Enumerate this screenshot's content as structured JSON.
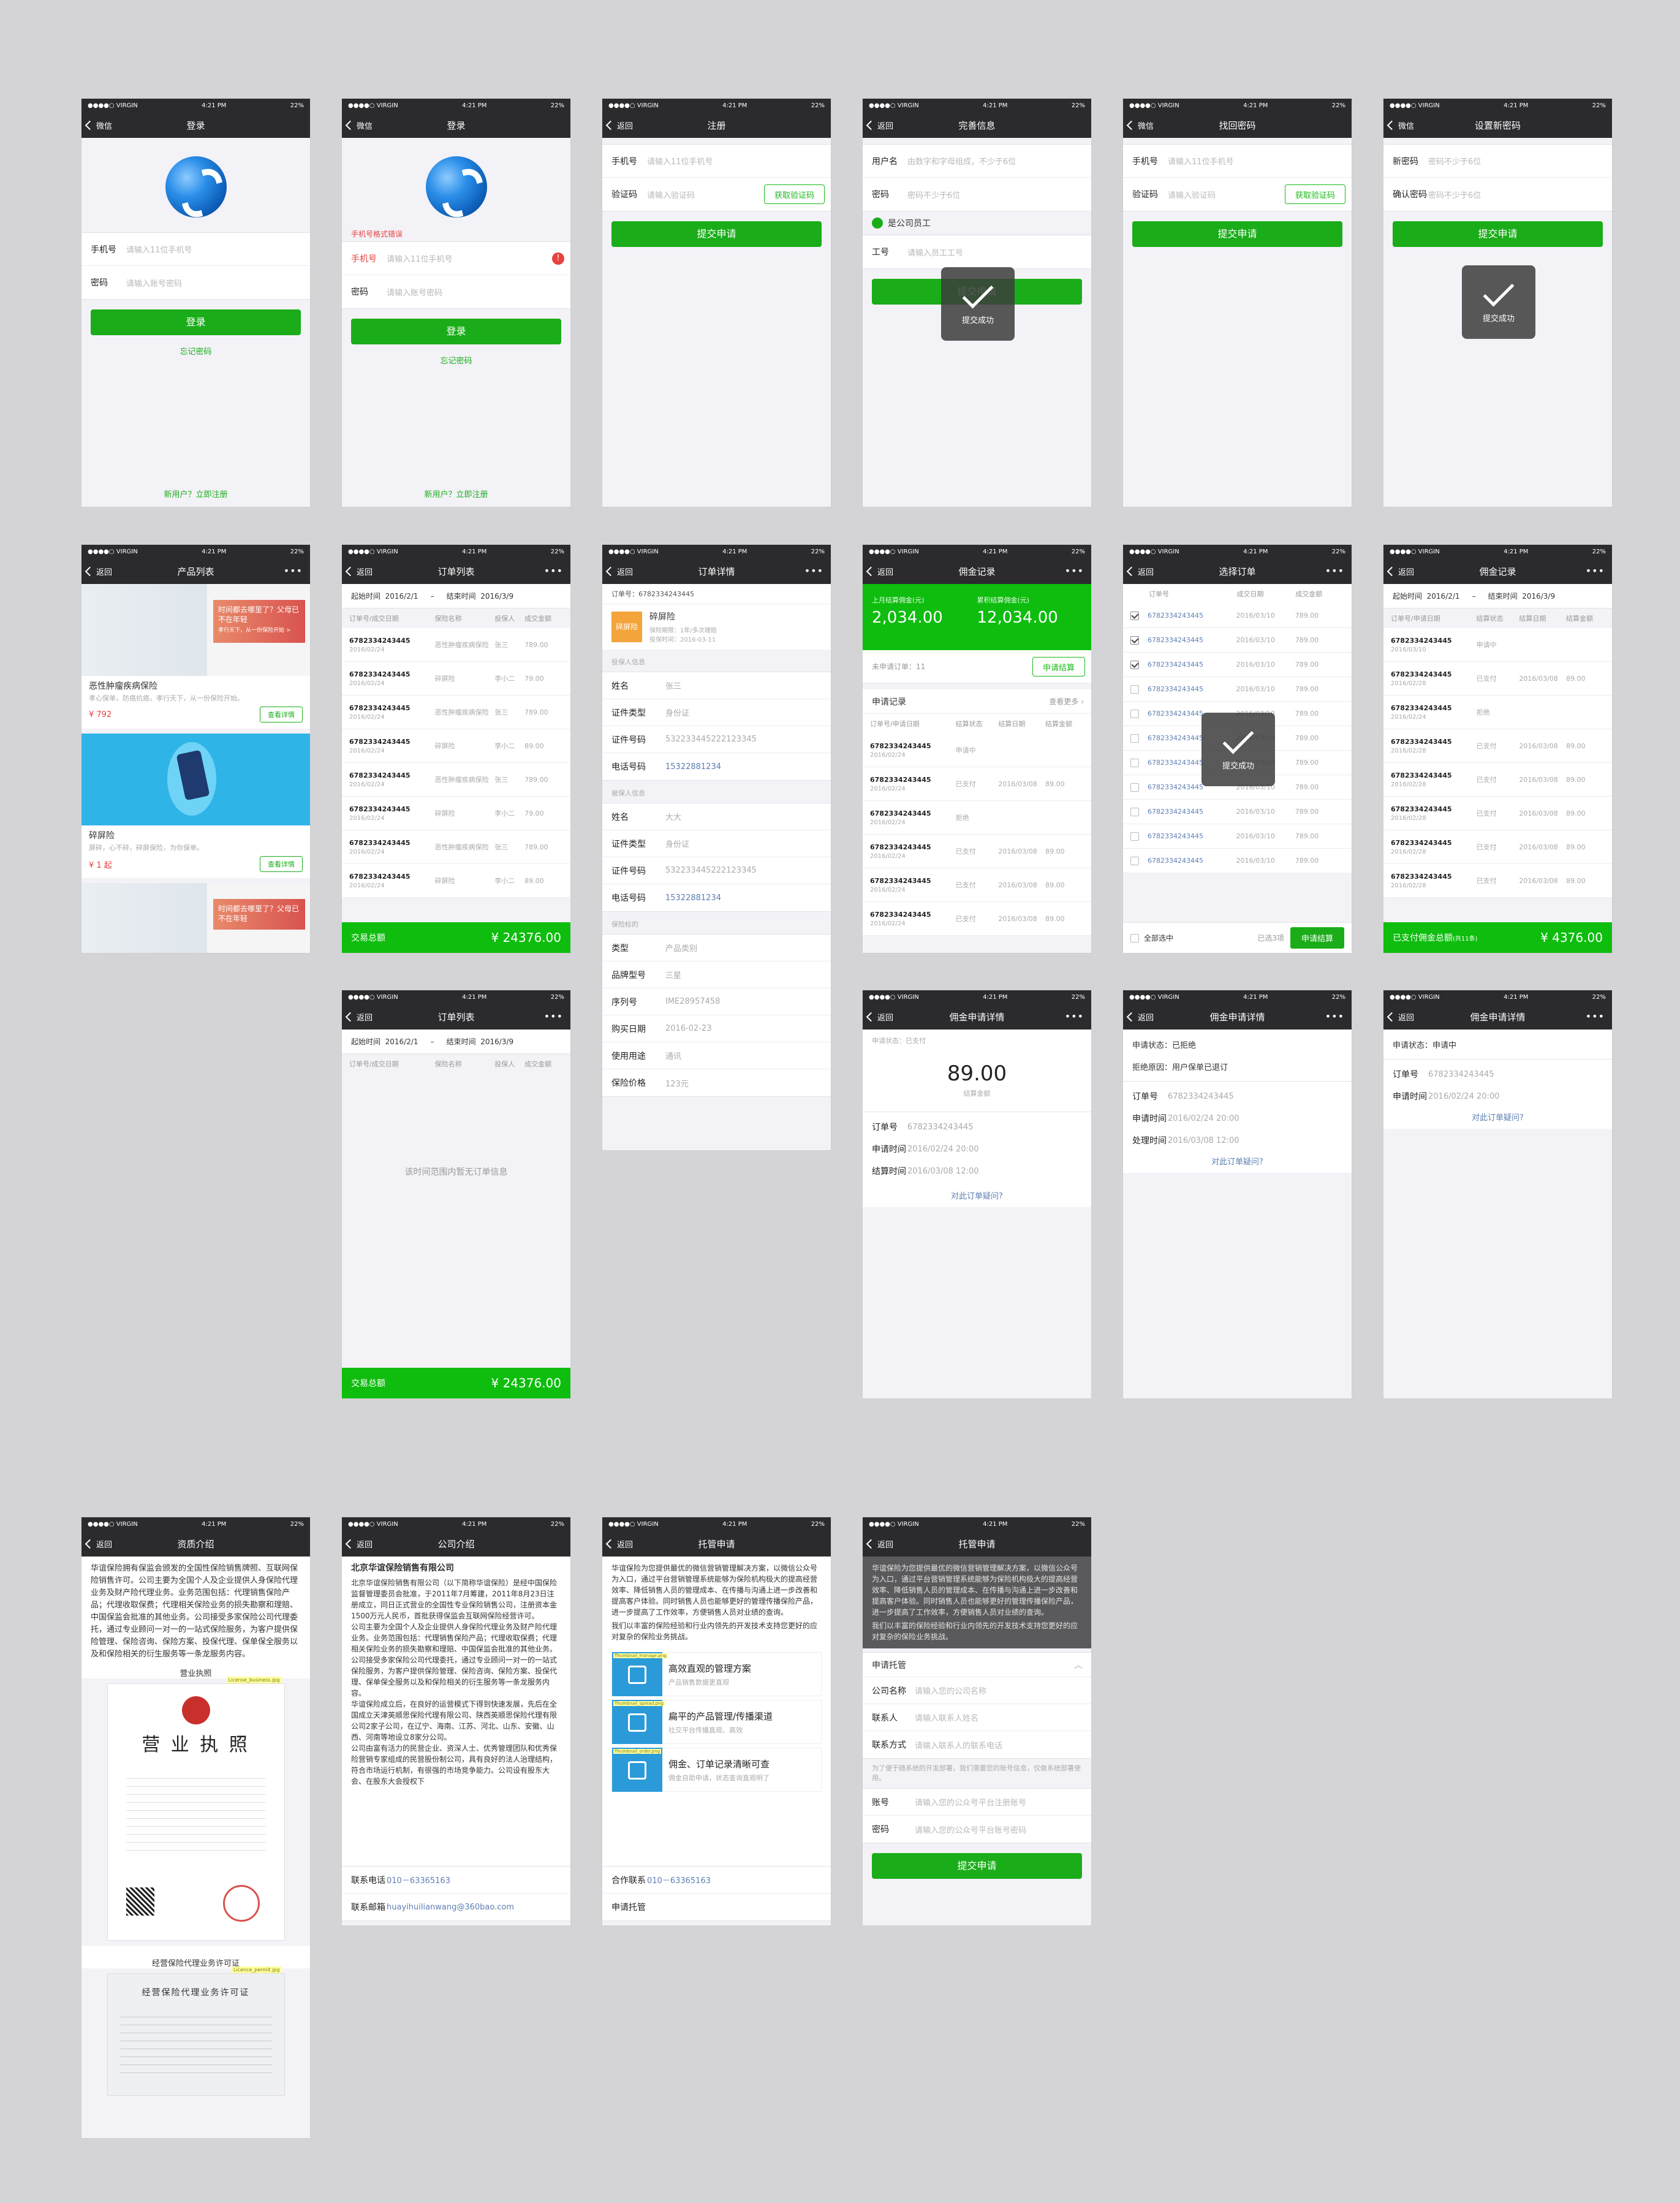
{
  "status": {
    "carrier": "●●●●○ VIRGIN",
    "time": "4:21 PM",
    "battery": "22%"
  },
  "common": {
    "back": "返回",
    "back_wechat": "微信",
    "more": "•••",
    "submit": "提交申请",
    "get_code": "获取验证码",
    "toast": "提交成功",
    "dispute": "对此订单疑问?",
    "order_no_label": "订单号",
    "apply_time_label": "申请时间",
    "settle_time_label": "结算时间",
    "process_time_label": "处理时间"
  },
  "login": {
    "title": "登录",
    "phone_label": "手机号",
    "phone_ph": "请输入11位手机号",
    "pwd_label": "密码",
    "pwd_ph": "请输入账号密码",
    "btn": "登录",
    "forgot": "忘记密码",
    "register": "新用户？立即注册",
    "error": "手机号格式错误",
    "err_icon": "!"
  },
  "register": {
    "title": "注册",
    "phone_label": "手机号",
    "phone_ph": "请输入11位手机号",
    "code_label": "验证码",
    "code_ph": "请输入验证码"
  },
  "complete": {
    "title": "完善信息",
    "user_label": "用户名",
    "user_ph": "由数字和字母组成，不少于6位",
    "pwd_label": "密码",
    "pwd_ph": "密码不少于6位",
    "employee": "是公司员工",
    "id_label": "工号",
    "id_ph": "请输入员工工号"
  },
  "recover": {
    "title": "找回密码"
  },
  "newpwd": {
    "title": "设置新密码",
    "new_label": "新密码",
    "new_ph": "密码不少于6位",
    "confirm_label": "确认密码",
    "confirm_ph": "密码不少于6位"
  },
  "products": {
    "title": "产品列表",
    "items": [
      {
        "name": "恶性肿瘤疾病保险",
        "desc": "孝心保单，防癌抗癌，孝行天下，从一份保险开始。",
        "price": "¥ 792",
        "view": "查看详情",
        "banner": "时间都去哪里了？父母已不在年轻",
        "banner_sub": "孝行天下，从一份保险开始 >"
      },
      {
        "name": "碎屏险",
        "desc": "屏碎，心不碎，碎屏保险，为你保单。",
        "price": "¥ 1 起",
        "view": "查看详情"
      }
    ],
    "third_banner": "时间都去哪里了？父母已不在年轻"
  },
  "orders": {
    "title": "订单列表",
    "from_label": "起始时间",
    "from": "2016/2/1",
    "sep": "–",
    "to_label": "结束时间",
    "to": "2016/3/9",
    "cols": [
      "订单号/成交日期",
      "保险名称",
      "投保人",
      "成交金额"
    ],
    "rows": [
      {
        "no": "6782334243445",
        "date": "2016/02/24",
        "name": "恶性肿瘤疾病保险",
        "holder": "张三",
        "amt": "789.00"
      },
      {
        "no": "6782334243445",
        "date": "2016/02/24",
        "name": "碎屏险",
        "holder": "李小二",
        "amt": "79.00"
      },
      {
        "no": "6782334243445",
        "date": "2016/02/24",
        "name": "恶性肿瘤疾病保险",
        "holder": "张三",
        "amt": "789.00"
      },
      {
        "no": "6782334243445",
        "date": "2016/02/24",
        "name": "碎屏险",
        "holder": "李小二",
        "amt": "89.00"
      },
      {
        "no": "6782334243445",
        "date": "2016/02/24",
        "name": "恶性肿瘤疾病保险",
        "holder": "张三",
        "amt": "789.00"
      },
      {
        "no": "6782334243445",
        "date": "2016/02/24",
        "name": "碎屏险",
        "holder": "李小二",
        "amt": "79.00"
      },
      {
        "no": "6782334243445",
        "date": "2016/02/24",
        "name": "恶性肿瘤疾病保险",
        "holder": "张三",
        "amt": "789.00"
      },
      {
        "no": "6782334243445",
        "date": "2016/02/24",
        "name": "碎屏险",
        "holder": "李小二",
        "amt": "89.00"
      }
    ],
    "total_label": "交易总额",
    "total": "¥ 24376.00",
    "empty": "该时间范围内暂无订单信息"
  },
  "order_detail": {
    "title": "订单详情",
    "order_no": "订单号：6782334243445",
    "product": "碎屏险",
    "logo_text": "碎屏险",
    "line1": "保险期限：1年/多次理赔",
    "line2": "投保时间：2016-03-11",
    "sec1": "投保人信息",
    "sec2": "被保人信息",
    "sec3": "保险标的",
    "holder": [
      {
        "k": "姓名",
        "v": "张三"
      },
      {
        "k": "证件类型",
        "v": "身份证"
      },
      {
        "k": "证件号码",
        "v": "532233445222123345"
      },
      {
        "k": "电话号码",
        "v": "15322881234"
      }
    ],
    "insured": [
      {
        "k": "姓名",
        "v": "大大"
      },
      {
        "k": "证件类型",
        "v": "身份证"
      },
      {
        "k": "证件号码",
        "v": "532233445222123345"
      },
      {
        "k": "电话号码",
        "v": "15322881234"
      }
    ],
    "target": [
      {
        "k": "类型",
        "v": "产品类别"
      },
      {
        "k": "品牌型号",
        "v": "三星"
      },
      {
        "k": "序列号",
        "v": "IME28957458"
      },
      {
        "k": "购买日期",
        "v": "2016-02-23"
      },
      {
        "k": "使用用途",
        "v": "通讯"
      },
      {
        "k": "保险价格",
        "v": "123元"
      }
    ]
  },
  "commission": {
    "title": "佣金记录",
    "last_label": "上月结算佣金(元)",
    "last": "2,034.00",
    "total_label": "累积结算佣金(元)",
    "total": "12,034.00",
    "unsettled": "未申请订单：11",
    "apply_btn": "申请结算",
    "record": "申请记录",
    "see_more": "查看更多 ›",
    "cols": [
      "订单号/申请日期",
      "结算状态",
      "结算日期",
      "结算金额"
    ],
    "rows": [
      {
        "no": "6782334243445",
        "date": "2016/02/24",
        "st": "申请中",
        "sd": "",
        "amt": "",
        "cls": ""
      },
      {
        "no": "6782334243445",
        "date": "2016/02/24",
        "st": "已支付",
        "sd": "2016/03/08",
        "amt": "89.00",
        "cls": "st-ok"
      },
      {
        "no": "6782334243445",
        "date": "2016/02/24",
        "st": "拒绝",
        "sd": "",
        "amt": "",
        "cls": "st-no"
      },
      {
        "no": "6782334243445",
        "date": "2016/02/24",
        "st": "已支付",
        "sd": "2016/03/08",
        "amt": "89.00",
        "cls": "st-ok"
      },
      {
        "no": "6782334243445",
        "date": "2016/02/24",
        "st": "已支付",
        "sd": "2016/03/08",
        "amt": "89.00",
        "cls": "st-ok"
      },
      {
        "no": "6782334243445",
        "date": "2016/02/24",
        "st": "已支付",
        "sd": "2016/03/08",
        "amt": "89.00",
        "cls": "st-ok"
      }
    ]
  },
  "select_order": {
    "title": "选择订单",
    "cols": [
      "订单号",
      "成交日期",
      "成交金额"
    ],
    "row_no": "6782334243445",
    "row_date": "2016/03/10",
    "row_amt": "789.00",
    "select_all": "全部选中",
    "selected": "已选3项",
    "apply": "申请结算"
  },
  "commission2": {
    "title": "佣金记录",
    "cols": [
      "订单号/申请日期",
      "结算状态",
      "结算日期",
      "结算金额"
    ],
    "rows": [
      {
        "no": "6782334243445",
        "date": "2016/03/10",
        "st": "申请中",
        "sd": "",
        "amt": "",
        "cls": ""
      },
      {
        "no": "6782334243445",
        "date": "2016/02/28",
        "st": "已支付",
        "sd": "2016/03/08",
        "amt": "89.00",
        "cls": "st-ok"
      },
      {
        "no": "6782334243445",
        "date": "2016/02/24",
        "st": "拒绝",
        "sd": "",
        "amt": "",
        "cls": "st-no"
      },
      {
        "no": "6782334243445",
        "date": "2016/02/28",
        "st": "已支付",
        "sd": "2016/03/08",
        "amt": "89.00",
        "cls": "st-ok"
      },
      {
        "no": "6782334243445",
        "date": "2016/02/28",
        "st": "已支付",
        "sd": "2016/03/08",
        "amt": "89.00",
        "cls": "st-ok"
      },
      {
        "no": "6782334243445",
        "date": "2016/02/28",
        "st": "已支付",
        "sd": "2016/03/08",
        "amt": "89.00",
        "cls": "st-ok"
      },
      {
        "no": "6782334243445",
        "date": "2016/02/28",
        "st": "已支付",
        "sd": "2016/03/08",
        "amt": "89.00",
        "cls": "st-ok"
      },
      {
        "no": "6782334243445",
        "date": "2016/02/28",
        "st": "已支付",
        "sd": "2016/03/08",
        "amt": "89.00",
        "cls": "st-ok"
      }
    ],
    "footer_label": "已支付佣金总额",
    "footer_count": "(共11条)",
    "footer_amt": "¥ 4376.00"
  },
  "apply_paid": {
    "title": "佣金申请详情",
    "status": "申请状态：已支付",
    "amount": "89.00",
    "amount_label": "结算金额",
    "order_no": "6782334243445",
    "apply_time": "2016/02/24  20:00",
    "settle_time": "2016/03/08  12:00"
  },
  "apply_rejected": {
    "title": "佣金申请详情",
    "status": "申请状态：已拒绝",
    "reason": "拒绝原因：用户保单已退订",
    "order_no": "6782334243445",
    "apply_time": "2016/02/24  20:00",
    "process_time": "2016/03/08  12:00"
  },
  "apply_pending": {
    "title": "佣金申请详情",
    "status": "申请状态：申请中",
    "order_no": "6782334243445",
    "apply_time": "2016/02/24  20:00"
  },
  "qualification": {
    "title": "资质介绍",
    "text": "华谊保险拥有保监会颁发的全国性保险销售牌照、互联网保险销售许可。公司主要为全国个人及企业提供人身保险代理业务及财产险代理业务。业务范围包括：代理销售保险产品；代理收取保费；代理相关保险业务的损失勘察和理赔、中国保监会批准的其他业务。公司接受多家保险公司代理委托，通过专业顾问一对一的一站式保险服务，为客户提供保险管理、保险咨询、保险方案、投保代理、保单保全服务以及和保险相关的衍生服务等一条龙服务内容。",
    "license_title": "营业执照",
    "license_big": "营 业 执 照",
    "license_tag": "License_business.jpg",
    "permit_title": "经营保险代理业务许可证",
    "permit_text": "经营保险代理业务许可证",
    "permit_tag": "Licence_permit.jpg"
  },
  "company": {
    "title": "公司介绍",
    "name": "北京华谊保险销售有限公司",
    "p1": "北京华谊保险销售有限公司（以下简称华谊保险）是经中国保险监督管理委员会批准，于2011年7月筹建，2011年8月23日注册成立，同日正式营业的全国性专业保险销售公司，注册资本金1500万元人民币，首批获得保监会互联网保险经营许可。",
    "p2": "公司主要为全国个人及企业提供人身保险代理业务及财产险代理业务。业务范围包括：代理销售保险产品；代理收取保费；代理相关保险业务的损失勘察和理赔、中国保监会批准的其他业务。公司接受多家保险公司代理委托，通过专业顾问一对一的一站式保险服务，为客户提供保险管理、保险咨询、保险方案、投保代理、保单保全服务以及和保险相关的衍生服务等一条龙服务内容。",
    "p3": "华谊保险成立后，在良好的运营模式下得到快速发展，先后在全国成立天津英顺思保险代理有限公司、陕西英顺思保险代理有限公司2家子公司，在辽宁、海南、江苏、河北、山东、安徽、山西、河南等地设立8家分公司。",
    "p4": "公司由富有活力的民营企业、资深人士、优秀管理团队和优秀保险营销专家组成的民营股份制公司，具有良好的法人治理结构，符合市场运行机制，有很强的市场竞争能力。公司设有股东大会、在股东大会授权下",
    "phone_label": "联系电话",
    "phone": "010－63365163",
    "email_label": "联系邮箱",
    "email": "huayihuilianwang@360bao.com"
  },
  "trust": {
    "title": "托管申请",
    "intro1": "华谊保险为您提供最优的微信营销管理解决方案，以微信公众号为入口，通过平台营销管理系统能够为保险机构极大的提高经营效率、降低销售人员的管理成本、在传播与沟通上进一步改善和提高客户体验。同时销售人员也能够更好的管理传播保险产品，进一步提高了工作效率，方便销售人员对业绩的查询。",
    "intro2": "我们以丰富的保险经验和行业内领先的开发技术支持您更好的应对复杂的保险业务挑战。",
    "features": [
      {
        "t": "高效直观的管理方案",
        "d": "产品销售数据更直观",
        "tag": "Thumbnail_manage.png"
      },
      {
        "t": "扁平的产品管理/传播渠道",
        "d": "社交平台传播直观、高效",
        "tag": "Thumbnail_spread.png"
      },
      {
        "t": "佣金、订单记录清晰可查",
        "d": "佣金自助申请，状态查询直观明了",
        "tag": "Thumbnail_order.png"
      }
    ],
    "coop_label": "合作联系",
    "coop": "010－63365163",
    "apply_label": "申请托管"
  },
  "trust_form": {
    "title": "托管申请",
    "section": "申请托管",
    "caret": "︿",
    "fields": [
      {
        "k": "公司名称",
        "ph": "请输入您的公司名称"
      },
      {
        "k": "联系人",
        "ph": "请输入联系人姓名"
      },
      {
        "k": "联系方式",
        "ph": "请输入联系人的联系电话"
      }
    ],
    "note": "为了便于随系统的开发部署，我们需要您的账号信息，仅做系统部署使用。",
    "account": [
      {
        "k": "账号",
        "ph": "请输入您的公众号平台注册账号"
      },
      {
        "k": "密码",
        "ph": "请输入您的公众号平台账号密码"
      }
    ],
    "submit": "提交申请"
  }
}
